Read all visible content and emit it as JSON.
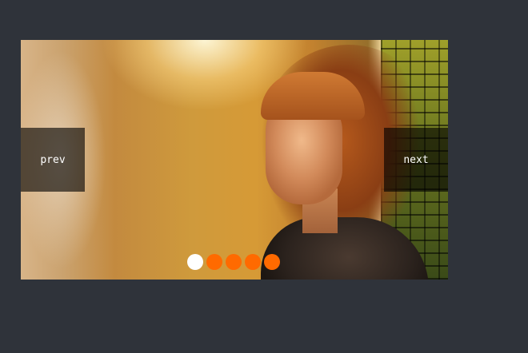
{
  "slider": {
    "prev_label": "prev",
    "next_label": "next",
    "active_index": 0,
    "dots": [
      {
        "color": "#ffffff"
      },
      {
        "color": "#ff6a00"
      },
      {
        "color": "#ff6a00"
      },
      {
        "color": "#ff6a00"
      },
      {
        "color": "#ff6a00"
      }
    ]
  },
  "colors": {
    "page_background": "#2f333a",
    "active_dot": "#ffffff",
    "inactive_dot": "#ff6a00"
  }
}
